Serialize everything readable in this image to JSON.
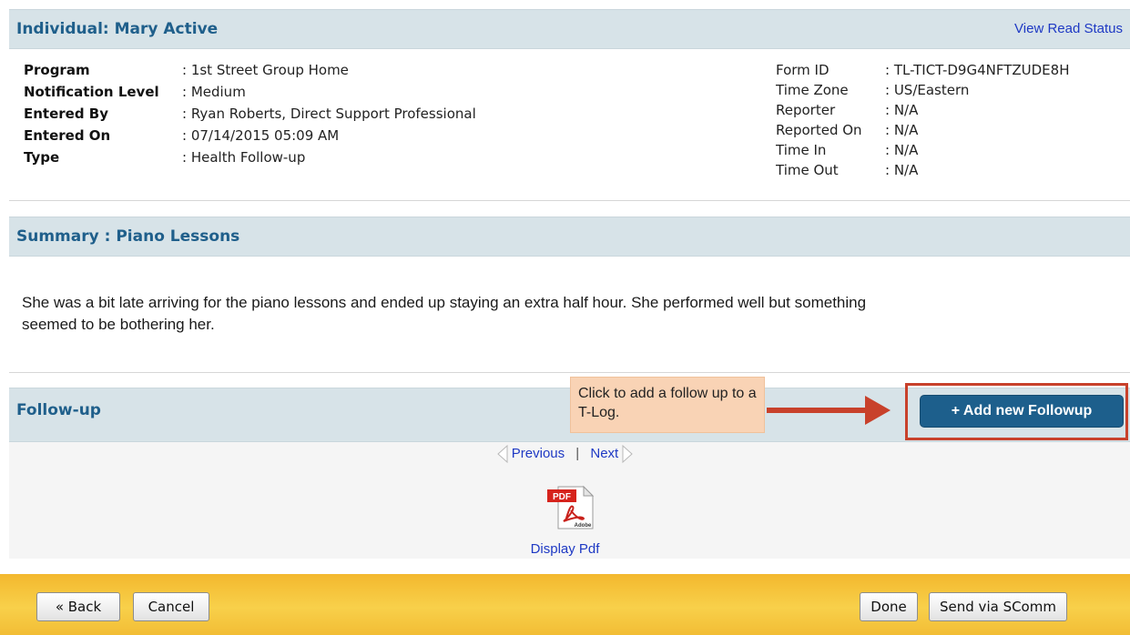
{
  "individual": {
    "title": "Individual: Mary Active",
    "view_read_status": "View Read Status"
  },
  "details_left": [
    {
      "label": "Program",
      "value": ": 1st Street Group Home"
    },
    {
      "label": "Notification Level",
      "value": ": Medium"
    },
    {
      "label": "Entered By",
      "value": ": Ryan Roberts, Direct Support Professional"
    },
    {
      "label": "Entered On",
      "value": ": 07/14/2015 05:09 AM"
    },
    {
      "label": "Type",
      "value": ": Health Follow-up"
    }
  ],
  "details_right": [
    {
      "label": "Form ID",
      "value": ": TL-TICT-D9G4NFTZUDE8H"
    },
    {
      "label": "Time Zone",
      "value": ": US/Eastern"
    },
    {
      "label": "Reporter",
      "value": ": N/A"
    },
    {
      "label": "Reported On",
      "value": ": N/A"
    },
    {
      "label": "Time In",
      "value": ": N/A"
    },
    {
      "label": "Time Out",
      "value": ": N/A"
    }
  ],
  "summary": {
    "title": "Summary : Piano Lessons",
    "text": "She was a bit late arriving for the piano lessons and ended up staying an extra half hour. She performed well but something seemed to be bothering her."
  },
  "followup": {
    "title": "Follow-up",
    "tooltip": "Click to add a follow up to a T-Log.",
    "add_button": "+ Add new Followup",
    "previous": "Previous",
    "separator": "|",
    "next": "Next",
    "display_pdf": "Display Pdf",
    "pdf_badge": "PDF",
    "pdf_brand": "Adobe"
  },
  "footer": {
    "back": "« Back",
    "cancel": "Cancel",
    "done": "Done",
    "send": "Send via SComm"
  },
  "colors": {
    "header_bg": "#d7e3e8",
    "title_blue": "#1f5f8b",
    "link_blue": "#1e39c4",
    "button_blue": "#1d5f8c",
    "callout_red": "#c8412b",
    "tooltip_bg": "#f9d3b5",
    "footer_yellow": "#f8d04a"
  }
}
